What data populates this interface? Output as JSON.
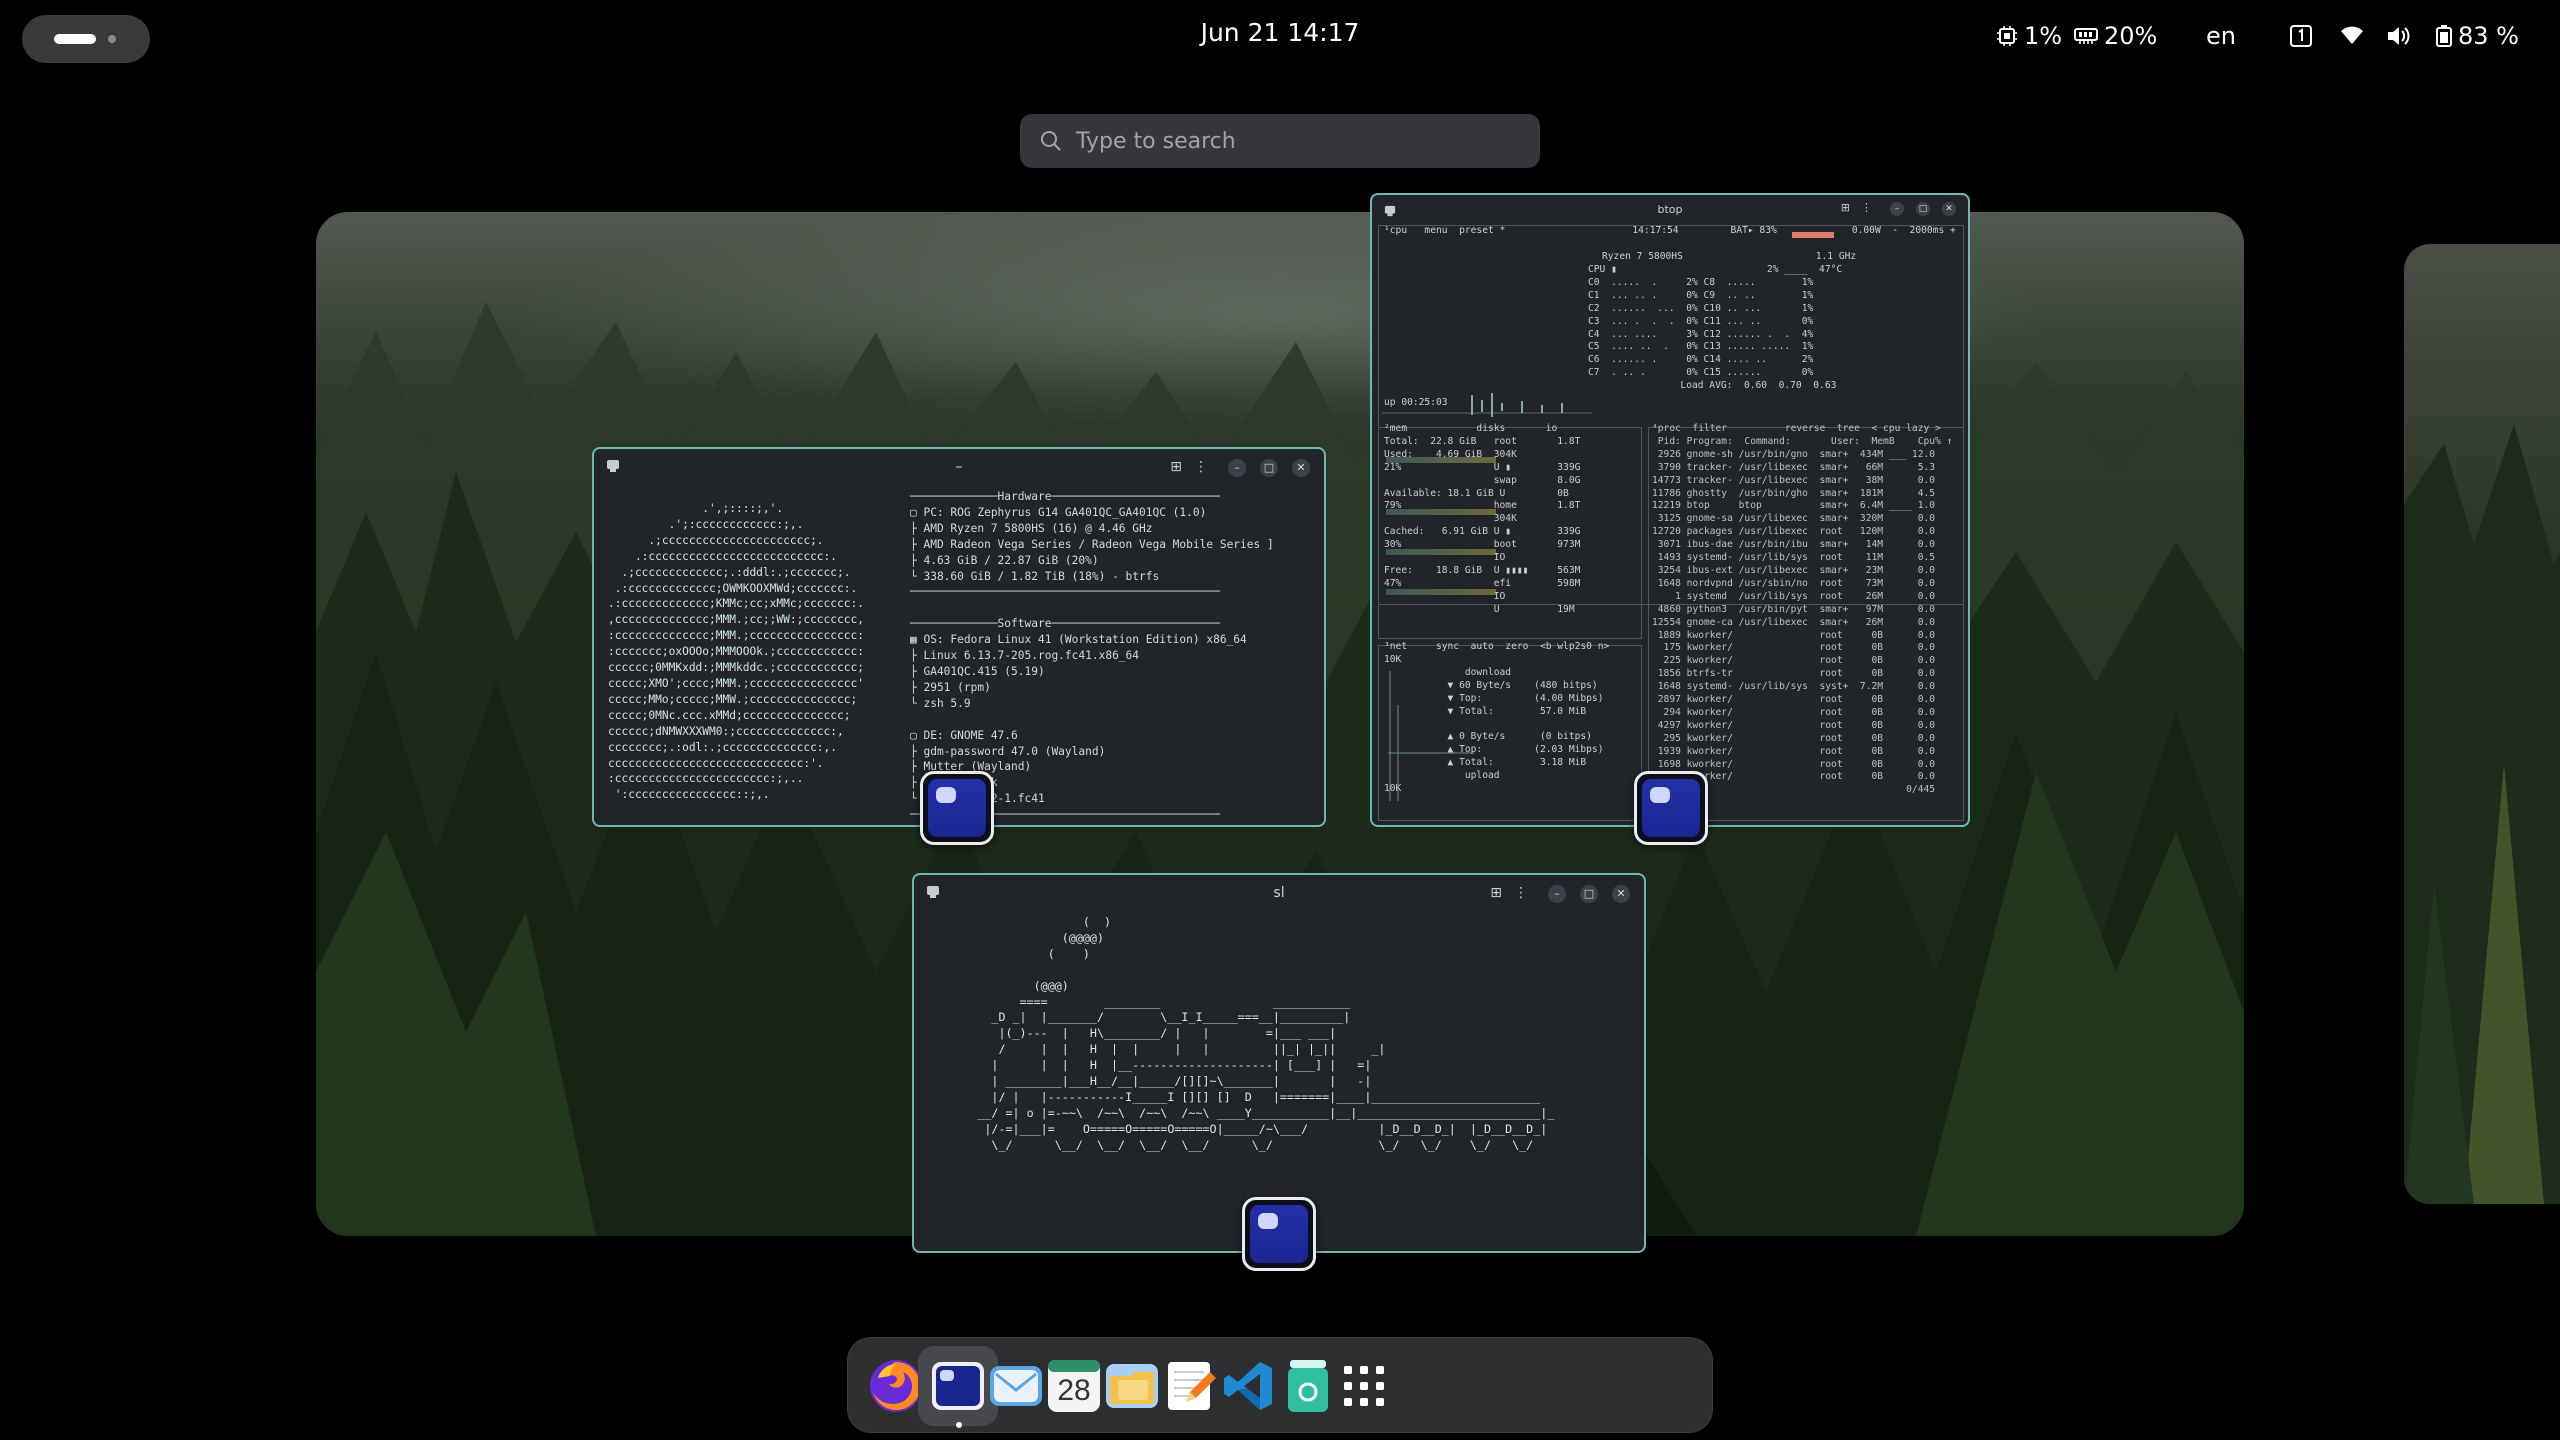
{
  "topbar": {
    "clock": "Jun 21  14:17",
    "cpu_label": "1%",
    "ram_label": "20%",
    "keyboard": "en",
    "battery": "83 %",
    "icons": [
      "activities-indicator",
      "cpu-icon",
      "memory-icon",
      "workspace-indicator-icon",
      "wifi-icon",
      "volume-icon",
      "battery-icon"
    ]
  },
  "search": {
    "placeholder": "Type to search"
  },
  "windows": {
    "fastfetch": {
      "title": "–",
      "logo": "              .',;::::;,'.\n         .';:cccccccccccc:;,.\n      .;cccccccccccccccccccccc;.\n    .:cccccccccccccccccccccccccc:.\n  .;ccccccccccccc;.:dddl:.;ccccccc;.\n .:ccccccccccccc;OWMKOOXMWd;ccccccc:.\n.:ccccccccccccc;KMMc;cc;xMMc;ccccccc:.\n,cccccccccccccc;MMM.;cc;;WW:;cccccccc,\n:cccccccccccccc;MMM.;cccccccccccccccc:\n:ccccccc;oxOOOo;MMMOOOk.;cccccccccccc:\ncccccc;0MMKxdd:;MMMkddc.;cccccccccccc;\nccccc;XMO';cccc;MMM.;cccccccccccccccc'\nccccc;MMo;ccccc;MMW.;ccccccccccccccc;\nccccc;0MNc.ccc.xMMd;ccccccccccccccc;\ncccccc;dNMWXXXWM0:;cccccccccccccc:,\ncccccccc;.:odl:.;cccccccccccccc:,.\nccccccccccccccccccccccccccccc:'.\n:ccccccccccccccccccccccc:;,..\n ':cccccccccccccccc::;,.",
      "info": "─────────────Hardware─────────────────────────\n▢ PC: ROG Zephyrus G14 GA401QC_GA401QC (1.0)\n├ AMD Ryzen 7 5800HS (16) @ 4.46 GHz\n├ AMD Radeon Vega Series / Radeon Vega Mobile Series ]\n├ 4.63 GiB / 22.87 GiB (20%)\n└ 338.60 GiB / 1.82 TiB (18%) - btrfs\n──────────────────────────────────────────────\n\n─────────────Software─────────────────────────\n▦ OS: Fedora Linux 41 (Workstation Edition) x86_64\n├ Linux 6.13.7-205.rog.fc41.x86_64\n├ GA401QC.415 (5.19)\n├ 2951 (rpm)\n└ zsh 5.9\n\n▢ DE: GNOME 47.6\n├ gdm-password 47.0 (Wayland)\n├ Mutter (Wayland)\n├ Forest-Dark\n└ kitty 1.1.2-1.fc41\n──────────────────────────────────────────────"
    },
    "btop": {
      "title": "btop",
      "header": "¹cpu   menu  preset *                      14:17:54         BAT▸ 83%             0.00W  -  2000ms +",
      "cpu_model": "Ryzen 7 5800HS                       1.1 GHz",
      "cores": "CPU ▮                          2% ____  47°C\nC0  .....  .     2% C8  .....        1%\nC1  ... .. .     0% C9  .. ..        1%\nC2  ......  ...  0% C10 .. ...       1%\nC3  ... .  .  .  0% C11 ... ..       0%\nC4  ... ....     3% C12 ...... .  .  4%\nC5  .... ..  .   0% C13 ..... .....  1%\nC6  ...... .     0% C14 .... ..      2%\nC7  . .. .       0% C15 ......       0%\n                Load AVG:  0.60  0.70  0.63",
      "uptime": "up 00:25:03",
      "mem": "²mem            disks       io\nTotal:  22.8 GiB   root       1.8T\nUsed:    4.69 GiB  304K\n21%                U ▮        339G\n                   swap       8.0G\nAvailable: 18.1 GiB U         0B\n79%                home       1.8T\n                   304K\nCached:   6.91 GiB U ▮        339G\n30%                boot       973M\n                   IO\nFree:    18.8 GiB  U ▮▮▮▮     563M\n47%                efi        598M\n                   IO\n                   U          19M",
      "net": "³net     sync  auto  zero  <b wlp2s0 n>\n10K\n              download\n           ▼ 60 Byte/s    (480 bitps)\n           ▼ Top:         (4.00 Mibps)\n           ▼ Total:        57.0 MiB\n\n           ▲ 0 Byte/s      (0 bitps)\n           ▲ Top:         (2.03 Mibps)\n           ▲ Total:        3.18 MiB\n              upload\n10K",
      "proc": "⁴proc  filter          reverse  tree  < cpu lazy >\n Pid: Program:  Command:       User:  MemB    Cpu% ↑\n 2926 gnome-sh /usr/bin/gno  smar+  434M ___ 12.0\n 3790 tracker- /usr/libexec  smar+   66M      5.3\n14773 tracker- /usr/libexec  smar+   38M      0.0\n11786 ghostty  /usr/bin/gho  smar+  181M      4.5\n12219 btop     btop          smar+  6.4M ____ 1.0\n 3125 gnome-sa /usr/libexec  smar+  320M      0.0\n12720 packages /usr/libexec  root   120M      0.0\n 3071 ibus-dae /usr/bin/ibu  smar+   14M      0.0\n 1493 systemd- /usr/lib/sys  root    11M      0.5\n 3254 ibus-ext /usr/libexec  smar+   23M      0.0\n 1648 nordvpnd /usr/sbin/no  root    73M      0.0\n    1 systemd  /usr/lib/sys  root    26M      0.0\n 4860 python3  /usr/bin/pyt  smar+   97M      0.0\n12554 gnome-ca /usr/libexec  smar+   26M      0.0\n 1889 kworker/               root     0B      0.0\n  175 kworker/               root     0B      0.0\n  225 kworker/               root     0B      0.0\n 1856 btrfs-tr               root     0B      0.0\n 1648 systemd- /usr/lib/sys  syst+  7.2M      0.0\n 2897 kworker/               root     0B      0.0\n  294 kworker/               root     0B      0.0\n 4297 kworker/               root     0B      0.0\n  295 kworker/               root     0B      0.0\n 1939 kworker/               root     0B      0.0\n 1698 kworker/               root     0B      0.0\n 1929 kworker/               root     0B      0.0\n                                            0/445"
    },
    "sl": {
      "title": "sl",
      "art": "                        (  )\n                     (@@@@)\n                   (    )\n\n                 (@@@)\n               ====        ________                ___________\n           _D _|  |_______/        \\__I_I_____===__|_________|\n            |(_)---  |   H\\________/ |   |        =|___ ___|\n            /     |  |   H  |  |     |   |         ||_| |_||     _|\n           |      |  |   H  |__--------------------| [___] |   =|\n           | ________|___H__/__|_____/[][]~\\_______|       |   -|\n           |/ |   |-----------I_____I [][] []  D   |=======|____|________________________\n         __/ =| o |=-~~\\  /~~\\  /~~\\  /~~\\ ____Y___________|__|__________________________|_\n          |/-=|___|=    O=====O=====O=====O|_____/~\\___/          |_D__D__D_|  |_D__D__D_|\n           \\_/      \\__/  \\__/  \\__/  \\__/      \\_/               \\_/   \\_/    \\_/   \\_/"
    }
  },
  "dock": {
    "items": [
      {
        "name": "Firefox",
        "active": false
      },
      {
        "name": "Terminal",
        "active": true
      },
      {
        "name": "Mail",
        "active": false
      },
      {
        "name": "Calendar",
        "active": false,
        "label": "28"
      },
      {
        "name": "Files",
        "active": false
      },
      {
        "name": "Text Editor",
        "active": false
      },
      {
        "name": "Visual Studio Code",
        "active": false
      },
      {
        "name": "Trash",
        "active": false
      },
      {
        "name": "Show Apps",
        "active": false
      }
    ]
  },
  "colors": {
    "window_border": "#6fb9b0",
    "terminal_bg": "#21252a",
    "dock_bg": "#2d2e30"
  }
}
